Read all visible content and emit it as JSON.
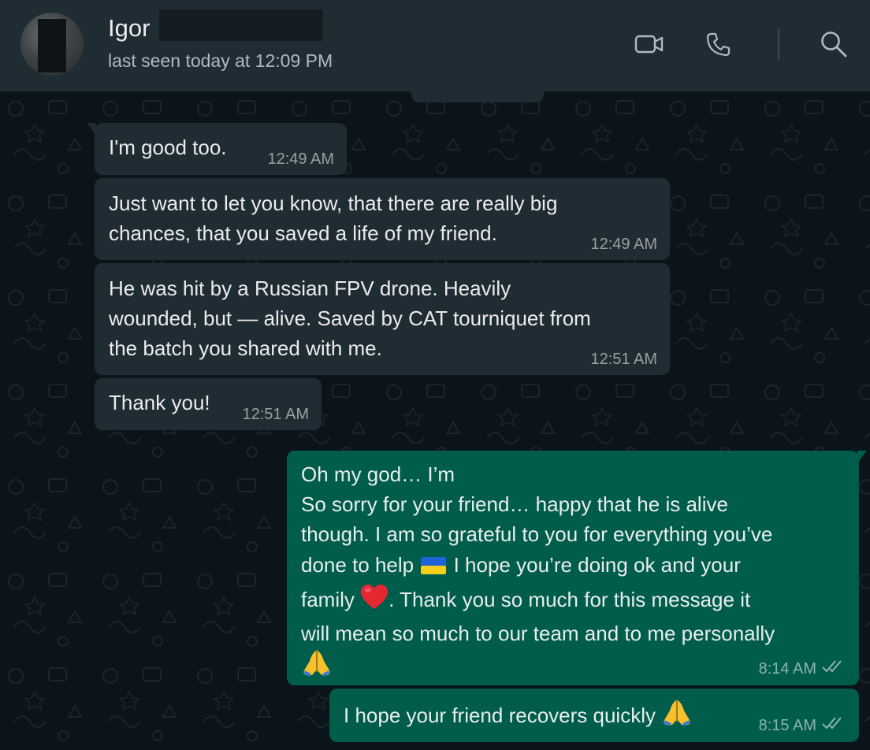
{
  "header": {
    "contact_name": "Igor",
    "last_seen": "last seen today at 12:09 PM",
    "icons": [
      "video-call-icon",
      "phone-icon",
      "search-icon"
    ]
  },
  "messages": [
    {
      "direction": "in",
      "text": "I'm good too.",
      "time": "12:49 AM"
    },
    {
      "direction": "in",
      "text": "Just want to let you know, that there are really big\nchances, that you saved a life of my friend.",
      "time": "12:49 AM"
    },
    {
      "direction": "in",
      "text": "He was hit by a Russian FPV drone. Heavily\nwounded, but — alive. Saved by CAT tourniquet from\nthe batch you shared with me.",
      "time": "12:51 AM"
    },
    {
      "direction": "in",
      "text": "Thank you!",
      "time": "12:51 AM"
    },
    {
      "direction": "out",
      "lines": [
        "Oh my god… I’m",
        "So sorry for your friend… happy that he is alive",
        "though. I am so grateful to you for everything you’ve",
        "done to help",
        "I hope you’re doing ok and your",
        "family",
        ". Thank you so much for this message it",
        "will mean so much to our team and to me personally"
      ],
      "emojis": [
        "ukraine-flag",
        "red-heart",
        "folded-hands"
      ],
      "time": "8:14 AM",
      "status": "read"
    },
    {
      "direction": "out",
      "text": "I hope your friend recovers quickly",
      "emoji": "folded-hands",
      "time": "8:15 AM",
      "status": "read"
    }
  ],
  "colors": {
    "header_bg": "#202c33",
    "chat_bg": "#0b141a",
    "incoming_bubble": "#202c33",
    "outgoing_bubble": "#005c4b",
    "text": "#e9edef",
    "secondary_text": "#aebac1"
  }
}
